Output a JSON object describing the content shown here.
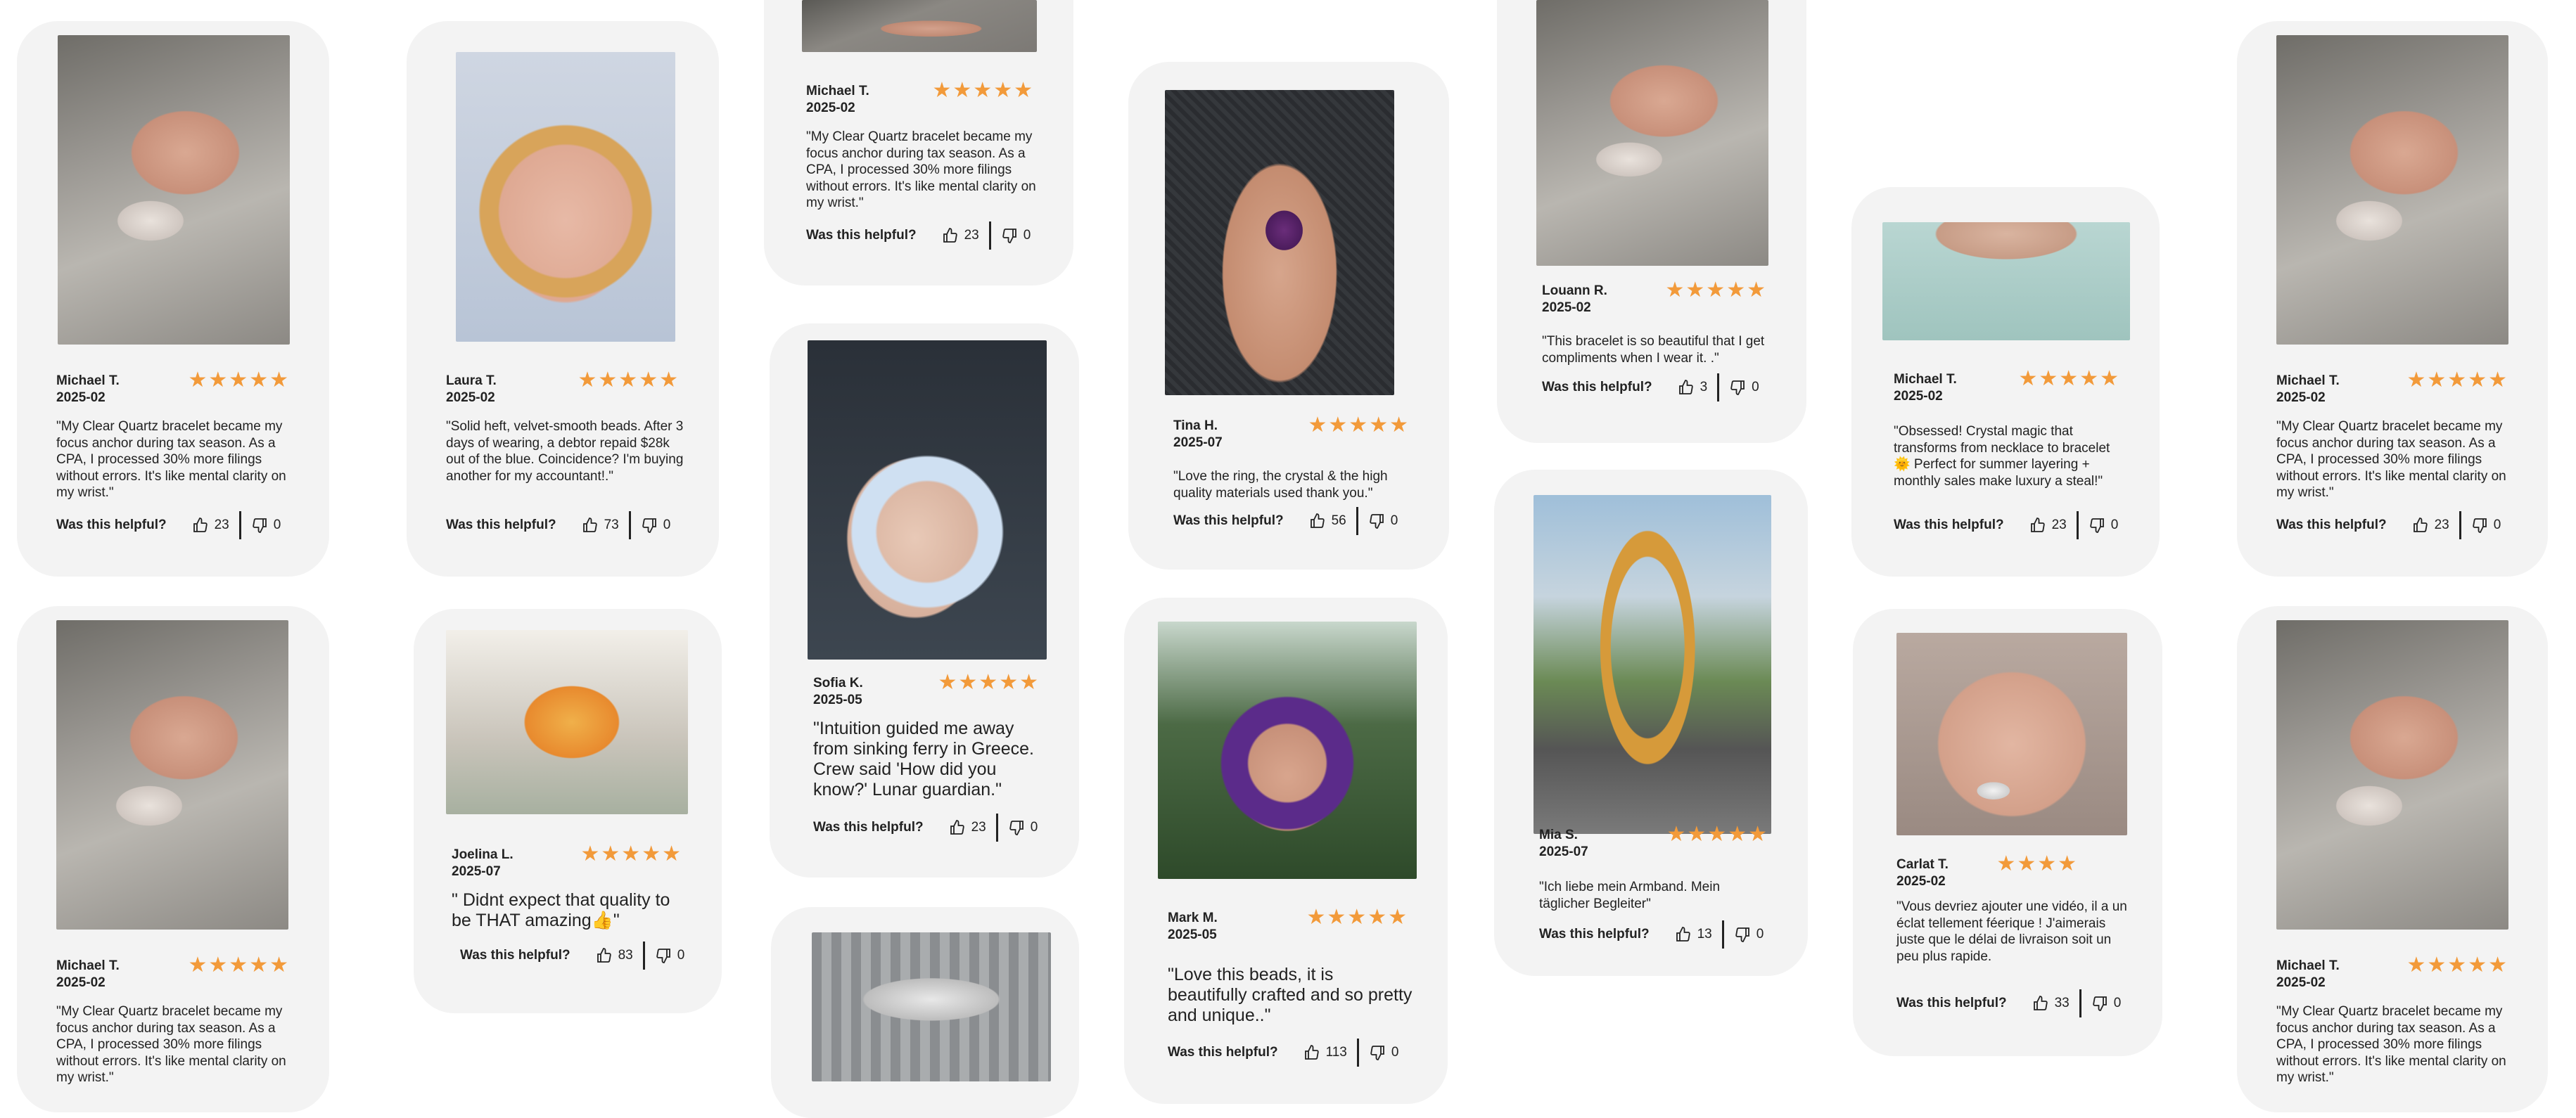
{
  "helpful_label": "Was this helpful?",
  "stars": "★★★★★",
  "stars4": "★★★★",
  "colors": {
    "card_bg": "#f3f3f3",
    "star": "#f29a3a",
    "text": "#222222"
  },
  "icons": {
    "up": "thumbs-up-icon",
    "down": "thumbs-down-icon"
  },
  "reviews": [
    {
      "name": "Michael T.",
      "date": "2025-02",
      "text": "\"My Clear Quartz bracelet became my focus anchor during tax season. As a CPA, I processed 30% more filings without errors. It's like mental clarity on my wrist.\"",
      "up": "23",
      "down": "0"
    },
    {
      "name": "Laura T.",
      "date": "2025-02",
      "text": "\"Solid heft, velvet-smooth beads. After 3 days of wearing, a debtor repaid $28k out of the blue. Coincidence? I'm buying another for my accountant!.\"",
      "up": "73",
      "down": "0"
    },
    {
      "name": "Michael T.",
      "date": "2025-02",
      "text": "\"My Clear Quartz bracelet became my focus anchor during tax season. As a CPA, I processed 30% more filings without errors. It's like mental clarity on my wrist.\"",
      "up": "23",
      "down": "0"
    },
    {
      "name": "Tina H.",
      "date": "2025-07",
      "text": "\"Love the ring, the crystal & the high quality materials used thank you.\"",
      "up": "56",
      "down": "0"
    },
    {
      "name": "Louann R.",
      "date": "2025-02",
      "text": "\"This bracelet is so beautiful that I get compliments when I wear it. .\"",
      "up": "3",
      "down": "0"
    },
    {
      "name": "Michael T.",
      "date": "2025-02",
      "text": "\"Obsessed! Crystal magic that transforms from necklace to bracelet 🌞 Perfect for summer layering + monthly sales make luxury a steal!\"",
      "up": "23",
      "down": "0"
    },
    {
      "name": "Michael T.",
      "date": "2025-02",
      "text": "\"My Clear Quartz bracelet became my focus anchor during tax season. As a CPA, I processed 30% more filings without errors. It's like mental clarity on my wrist.\"",
      "up": "23",
      "down": "0"
    },
    {
      "name": "Michael T.",
      "date": "2025-02",
      "text": "\"My Clear Quartz bracelet became my focus anchor during tax season. As a CPA, I processed 30% more filings without errors. It's like mental clarity on my wrist.\"",
      "up": "23",
      "down": "0"
    },
    {
      "name": "Joelina L.",
      "date": "2025-07",
      "text": "\" Didnt expect that quality to be THAT amazing👍\"",
      "up": "83",
      "down": "0"
    },
    {
      "name": "Sofia K.",
      "date": "2025-05",
      "text": "\"Intuition guided me away from sinking ferry in Greece. Crew said 'How did you know?' Lunar guardian.\"",
      "up": "23",
      "down": "0"
    },
    {
      "name": "Mark M.",
      "date": "2025-05",
      "text": "\"Love this beads, it is beautifully crafted and so pretty and unique..\"",
      "up": "113",
      "down": "0"
    },
    {
      "name": "Mia S.",
      "date": "2025-07",
      "text": "\"Ich liebe mein Armband. Mein täglicher Begleiter\"",
      "up": "13",
      "down": "0"
    },
    {
      "name": "Carlat T.",
      "date": "2025-02",
      "text": "\"Vous devriez ajouter une vidéo, il a un éclat tellement féerique ! J'aimerais juste que le délai de livraison soit un peu plus rapide.",
      "up": "33",
      "down": "0"
    },
    {
      "name": "Michael T.",
      "date": "2025-02",
      "text": "\"My Clear Quartz bracelet became my focus anchor during tax season. As a CPA, I processed 30% more filings without errors. It's like mental clarity on my wrist.\"",
      "up": "23",
      "down": "0"
    }
  ]
}
